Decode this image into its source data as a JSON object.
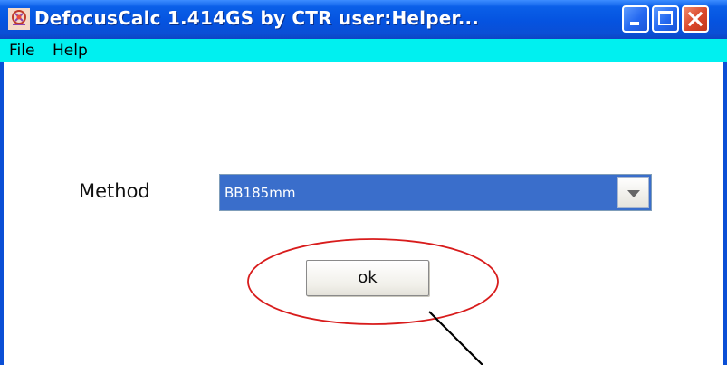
{
  "window": {
    "title": "DefocusCalc 1.414GS by CTR  user:Helper...",
    "app_icon": "app-flower-icon",
    "controls": {
      "minimize_icon": "minimize-icon",
      "maximize_icon": "maximize-icon",
      "close_icon": "close-icon",
      "close_glyph": "✕"
    }
  },
  "menubar": {
    "items": [
      {
        "label": "File"
      },
      {
        "label": "Help"
      }
    ]
  },
  "form": {
    "method_label": "Method",
    "method_value": "BB185mm",
    "dropdown_icon": "chevron-down-icon",
    "ok_label": "ok"
  },
  "annotations": {
    "highlight_ellipse_color": "#d81c1c",
    "pointer_line_color": "#000000"
  },
  "colors": {
    "titlebar": "#0553e0",
    "menubar": "#00f0f0",
    "selected_item": "#3a6ecb"
  }
}
